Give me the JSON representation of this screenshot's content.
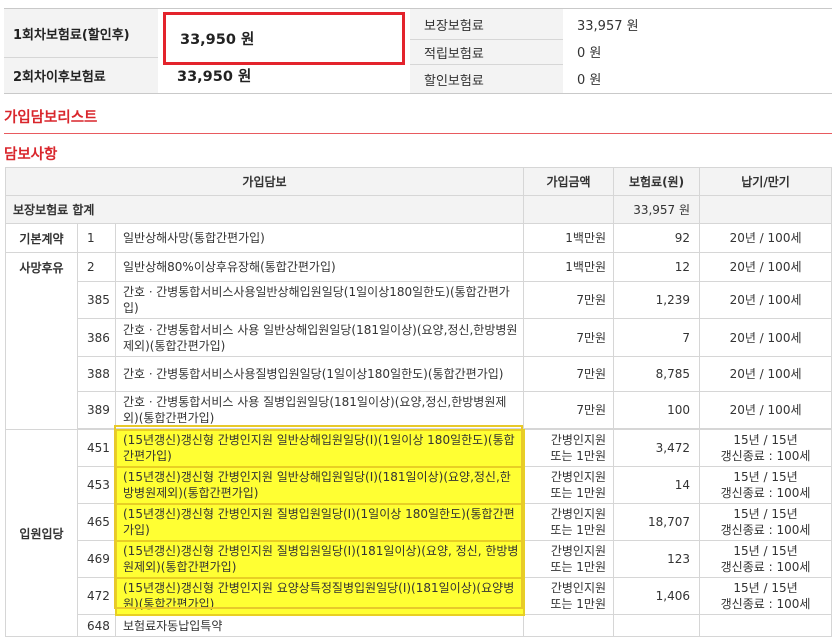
{
  "summary": {
    "first_premium_label": "1회차보험료(할인후)",
    "first_premium_value": "33,950 원",
    "later_premium_label": "2회차이후보험료",
    "later_premium_value": "33,950 원",
    "guarantee_label": "보장보험료",
    "guarantee_value": "33,957 원",
    "saving_label": "적립보험료",
    "saving_value": "0 원",
    "discount_label": "할인보험료",
    "discount_value": "0 원"
  },
  "sections": {
    "list_title": "가입담보리스트",
    "detail_title": "담보사항"
  },
  "table": {
    "headers": [
      "가입담보",
      "가입금액",
      "보험료(원)",
      "납기/만기"
    ],
    "total_label": "보장보험료 합계",
    "total_value": "33,957 원",
    "categories": [
      "기본계약",
      "사망후유",
      "입원입당"
    ],
    "rows": [
      {
        "no": "1",
        "name": "일반상해사망(통합간편가입)",
        "amount": "1백만원",
        "premium": "92",
        "term": "20년 / 100세"
      },
      {
        "no": "2",
        "name": "일반상해80%이상후유장해(통합간편가입)",
        "amount": "1백만원",
        "premium": "12",
        "term": "20년 / 100세"
      },
      {
        "no": "385",
        "name": "간호ㆍ간병통합서비스사용일반상해입원일당(1일이상180일한도)(통합간편가입)",
        "amount": "7만원",
        "premium": "1,239",
        "term": "20년 / 100세"
      },
      {
        "no": "386",
        "name": "간호ㆍ간병통합서비스 사용 일반상해입원일당(181일이상)(요양,정신,한방병원제외)(통합간편가입)",
        "amount": "7만원",
        "premium": "7",
        "term": "20년 / 100세"
      },
      {
        "no": "388",
        "name": "간호ㆍ간병통합서비스사용질병입원일당(1일이상180일한도)(통합간편가입)",
        "amount": "7만원",
        "premium": "8,785",
        "term": "20년 / 100세"
      },
      {
        "no": "389",
        "name": "간호ㆍ간병통합서비스 사용 질병입원일당(181일이상)(요양,정신,한방병원제외)(통합간편가입)",
        "amount": "7만원",
        "premium": "100",
        "term": "20년 / 100세"
      },
      {
        "no": "451",
        "name": "(15년갱신)갱신형 간병인지원 일반상해입원일당(Ⅰ)(1일이상 180일한도)(통합간편가입)",
        "amount_1": "간병인지원",
        "amount_2": "또는 1만원",
        "premium": "3,472",
        "term_1": "15년 / 15년",
        "term_2": "갱신종료 : 100세"
      },
      {
        "no": "453",
        "name": "(15년갱신)갱신형 간병인지원 일반상해입원일당(Ⅰ)(181일이상)(요양,정신,한방병원제외)(통합간편가입)",
        "amount_1": "간병인지원",
        "amount_2": "또는 1만원",
        "premium": "14",
        "term_1": "15년 / 15년",
        "term_2": "갱신종료 : 100세"
      },
      {
        "no": "465",
        "name": "(15년갱신)갱신형 간병인지원 질병입원일당(Ⅰ)(1일이상 180일한도)(통합간편가입)",
        "amount_1": "간병인지원",
        "amount_2": "또는 1만원",
        "premium": "18,707",
        "term_1": "15년 / 15년",
        "term_2": "갱신종료 : 100세"
      },
      {
        "no": "469",
        "name": "(15년갱신)갱신형 간병인지원 질병입원일당(Ⅰ)(181일이상)(요양, 정신, 한방병원제외)(통합간편가입)",
        "amount_1": "간병인지원",
        "amount_2": "또는 1만원",
        "premium": "123",
        "term_1": "15년 / 15년",
        "term_2": "갱신종료 : 100세"
      },
      {
        "no": "472",
        "name": "(15년갱신)갱신형 간병인지원 요양상특정질병입원일당(Ⅰ)(181일이상)(요양병원)(통합간편가입)",
        "amount_1": "간병인지원",
        "amount_2": "또는 1만원",
        "premium": "1,406",
        "term_1": "15년 / 15년",
        "term_2": "갱신종료 : 100세"
      },
      {
        "no": "648",
        "name": "보험료자동납입특약",
        "amount": "",
        "premium": "",
        "term": ""
      }
    ]
  }
}
